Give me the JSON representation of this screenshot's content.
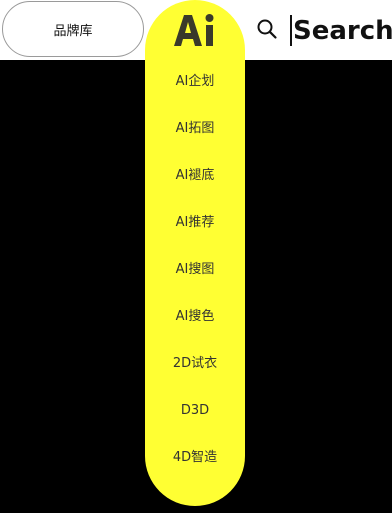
{
  "header": {
    "brand_library_label": "品牌库",
    "search_placeholder": "Search"
  },
  "ai_menu": {
    "logo_text": "Ai",
    "items": [
      {
        "label": "AI企划"
      },
      {
        "label": "AI拓图"
      },
      {
        "label": "AI褪底"
      },
      {
        "label": "AI推荐"
      },
      {
        "label": "AI搜图"
      },
      {
        "label": "AI搜色"
      },
      {
        "label": "2D试衣"
      },
      {
        "label": "D3D"
      },
      {
        "label": "4D智造"
      }
    ]
  },
  "colors": {
    "menu_background": "#ffff33",
    "page_background": "#000000",
    "header_background": "#ffffff",
    "logo_color": "#3a3a2a"
  },
  "icons": {
    "search": "search-icon",
    "logo": "ai-logo-icon"
  }
}
